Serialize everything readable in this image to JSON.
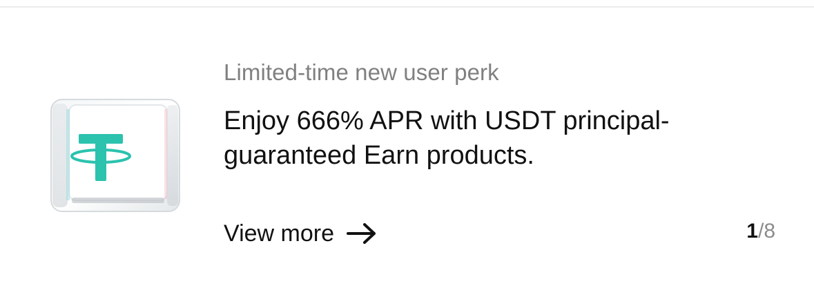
{
  "promo": {
    "subtitle": "Limited-time new user perk",
    "headline_line1": "Enjoy 666% APR with USDT principal-",
    "headline_line2": "guaranteed Earn products.",
    "view_more_label": "View more",
    "image_icon": "tether-usdt-cube-icon",
    "arrow_icon": "arrow-right-icon"
  },
  "pager": {
    "current": "1",
    "separator": "/",
    "total": "8"
  },
  "colors": {
    "tether_green": "#2bc2ae",
    "text_primary": "#111111",
    "text_secondary": "#808080"
  }
}
